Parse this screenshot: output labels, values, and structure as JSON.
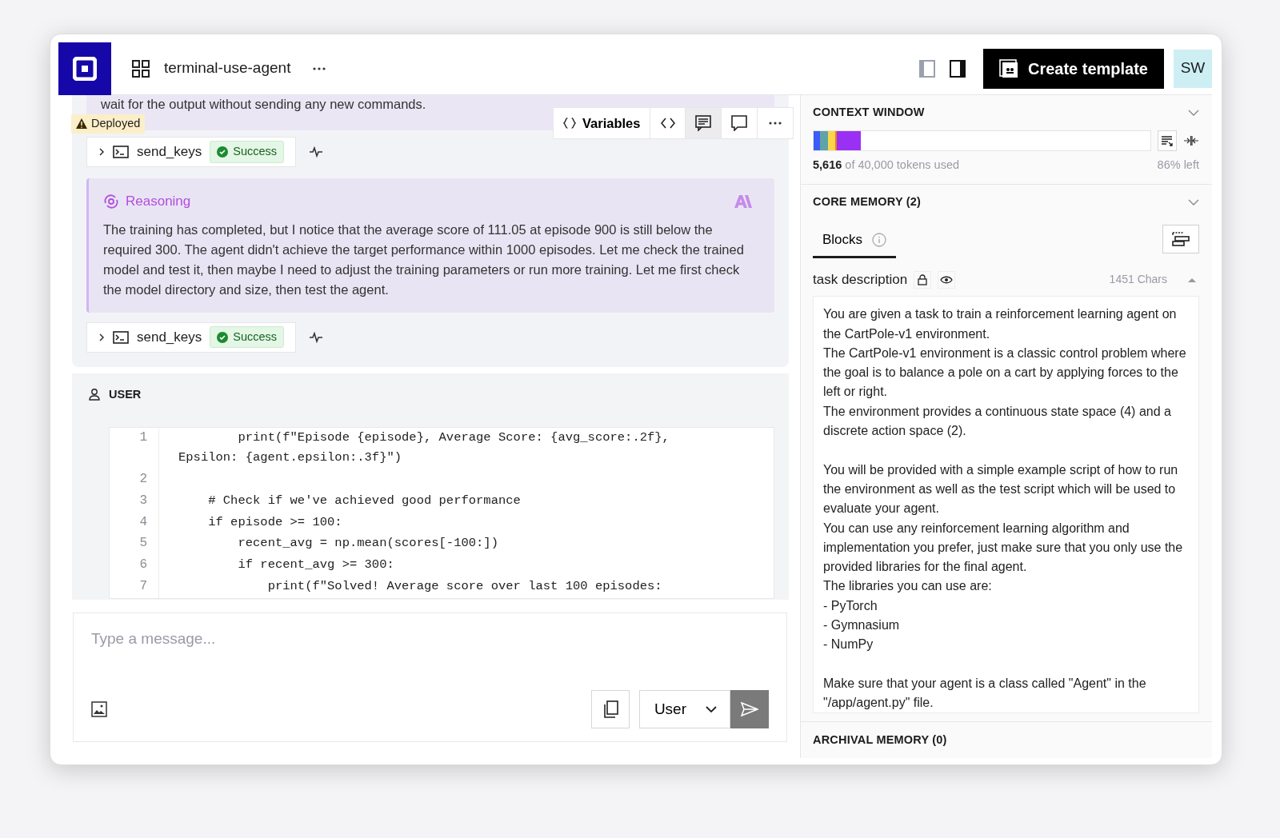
{
  "header": {
    "project": "terminal-use-agent",
    "create_button": "Create template",
    "avatar": "SW"
  },
  "status_badge": "Deployed",
  "toolbar": [
    {
      "kind": "variables",
      "label": "Variables",
      "selected": false
    },
    {
      "kind": "code",
      "selected": false
    },
    {
      "kind": "messages",
      "selected": true
    },
    {
      "kind": "comment",
      "selected": false
    },
    {
      "kind": "more",
      "selected": false
    }
  ],
  "agent_message": {
    "text_fragment": "wait for the output without sending any new commands.",
    "steps": [
      {
        "kind": "tool",
        "name": "send_keys",
        "status": "Success"
      },
      {
        "kind": "reasoning",
        "title": "Reasoning",
        "text": "The training has completed, but I notice that the average score of 111.05 at episode 900 is still below the required 300. The agent didn't achieve the target performance within 1000 episodes. Let me check the trained model and test it, then maybe I need to adjust the training parameters or run more training. Let me first check the model directory and size, then test the agent."
      },
      {
        "kind": "tool",
        "name": "send_keys",
        "status": "Success"
      }
    ]
  },
  "user_message": {
    "role": "USER",
    "code_lines": [
      {
        "number": "1",
        "text": "        print(f\"Episode {episode}, Average Score: {avg_score:.2f}, Epsilon: {agent.epsilon:.3f}\")"
      },
      {
        "number": "2"
      },
      {
        "number": "3",
        "text": "    # Check if we've achieved good performance"
      },
      {
        "number": "4",
        "text": "    if episode >= 100:"
      },
      {
        "number": "5",
        "text": "        recent_avg = np.mean(scores[-100:])"
      },
      {
        "number": "6",
        "text": "        if recent_avg >= 300:"
      },
      {
        "number": "7",
        "text": "            print(f\"Solved! Average score over last 100 episodes:"
      }
    ]
  },
  "composer": {
    "placeholder": "Type a message...",
    "role": "User"
  },
  "context_window": {
    "title": "CONTEXT WINDOW",
    "segments": [
      {
        "color": "#3b5cf6",
        "level": 0.02
      },
      {
        "color": "#5fa3a8",
        "level": 0.023
      },
      {
        "color": "#fcd64a",
        "level": 0.021
      },
      {
        "color": "#f07b1c",
        "level": 0.004
      },
      {
        "color": "#9b30f5",
        "level": 0.072
      }
    ],
    "used": "5,616",
    "total": "of 40,000 tokens used",
    "remaining": "86% left"
  },
  "core_memory": {
    "title": "CORE MEMORY (2)",
    "tabs": [
      {
        "label": "Blocks",
        "selected": true
      }
    ],
    "block": {
      "label": "task description",
      "chars": "1451 Chars",
      "text": "You are given a task to train a reinforcement learning agent on the CartPole-v1 environment.\nThe CartPole-v1 environment is a classic control problem where the goal is to balance a pole on a cart by applying forces to the left or right.\nThe environment provides a continuous state space (4) and a discrete action space (2).\n\nYou will be provided with a simple example script of how to run the environment as well as the test script which will be used to evaluate your agent.\nYou can use any reinforcement learning algorithm and implementation you prefer, just make sure that you only use the provided libraries for the final agent.\nThe libraries you can use are:\n- PyTorch\n- Gymnasium\n- NumPy\n\nMake sure that your agent is a class called \"Agent\" in the \"/app/agent.py\" file."
    }
  },
  "archival_memory": {
    "title": "ARCHIVAL MEMORY (0)"
  }
}
